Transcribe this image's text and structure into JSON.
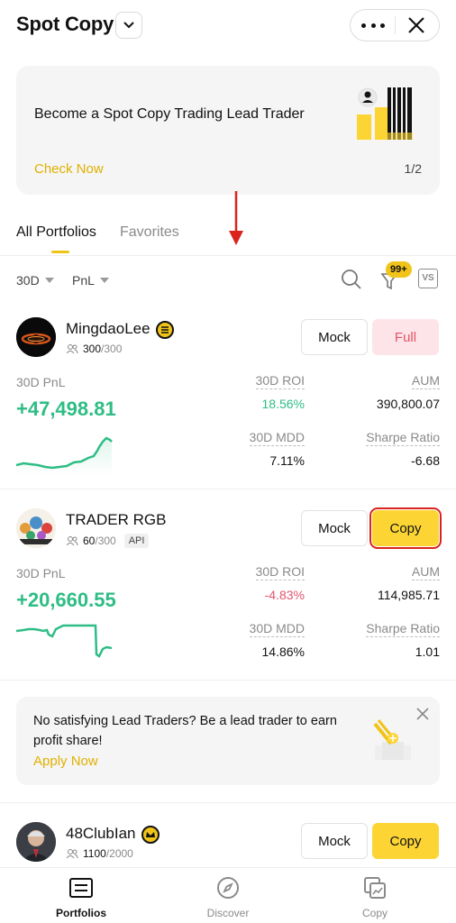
{
  "header": {
    "title": "Spot Copy"
  },
  "banner": {
    "title": "Become a Spot Copy Trading Lead Trader",
    "link": "Check Now",
    "page": "1/2"
  },
  "tabs": [
    {
      "label": "All Portfolios",
      "active": true
    },
    {
      "label": "Favorites",
      "active": false
    }
  ],
  "filters": {
    "period": "30D",
    "sort": "PnL",
    "badge": "99+",
    "compare": "VS"
  },
  "traders": [
    {
      "name": "MingdaoLee",
      "followers": "300",
      "capacity": "/300",
      "mock_label": "Mock",
      "action_label": "Full",
      "pnl_label": "30D PnL",
      "pnl": "+47,498.81",
      "roi_label": "30D  ROI",
      "roi": "18.56%",
      "aum_label": "AUM",
      "aum": "390,800.07",
      "mdd_label": "30D MDD",
      "mdd": "7.11%",
      "sharpe_label": "Sharpe Ratio",
      "sharpe": "-6.68"
    },
    {
      "name": "TRADER RGB",
      "followers": "60",
      "capacity": "/300",
      "tag": "API",
      "mock_label": "Mock",
      "action_label": "Copy",
      "pnl_label": "30D PnL",
      "pnl": "+20,660.55",
      "roi_label": "30D  ROI",
      "roi": "-4.83%",
      "aum_label": "AUM",
      "aum": "114,985.71",
      "mdd_label": "30D MDD",
      "mdd": "14.86%",
      "sharpe_label": "Sharpe Ratio",
      "sharpe": "1.01"
    },
    {
      "name": "48ClubIan",
      "followers": "1100",
      "capacity": "/2000",
      "mock_label": "Mock",
      "action_label": "Copy"
    }
  ],
  "promo": {
    "text": "No satisfying Lead Traders? Be a lead trader to earn profit share!",
    "link": "Apply Now"
  },
  "nav": [
    {
      "label": "Portfolios",
      "icon": "portfolios-icon",
      "active": true
    },
    {
      "label": "Discover",
      "icon": "compass-icon",
      "active": false
    },
    {
      "label": "Copy",
      "icon": "copy-icon",
      "active": false
    }
  ],
  "colors": {
    "accent": "#fcd535",
    "green": "#2ebd85",
    "red": "#e5546b"
  }
}
